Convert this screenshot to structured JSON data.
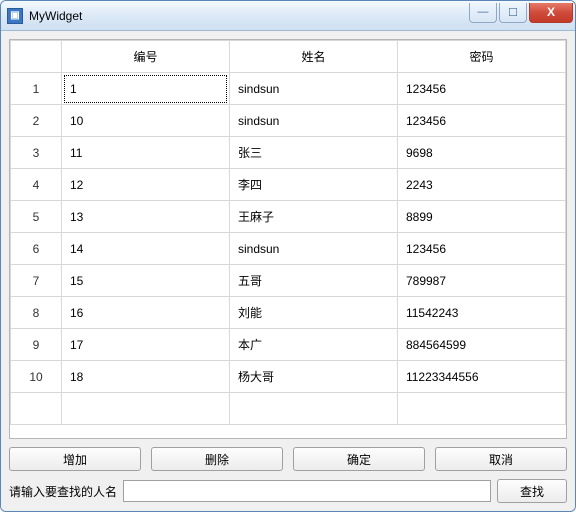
{
  "window": {
    "title": "MyWidget",
    "icon_glyph": "▣"
  },
  "window_controls": {
    "min": "—",
    "max": "☐",
    "close": "X"
  },
  "table": {
    "headers": {
      "id": "编号",
      "name": "姓名",
      "pwd": "密码"
    },
    "rows": [
      {
        "n": "1",
        "id": "1",
        "name": "sindsun",
        "pwd": "123456"
      },
      {
        "n": "2",
        "id": "10",
        "name": "sindsun",
        "pwd": "123456"
      },
      {
        "n": "3",
        "id": "11",
        "name": "张三",
        "pwd": "9698"
      },
      {
        "n": "4",
        "id": "12",
        "name": "李四",
        "pwd": "2243"
      },
      {
        "n": "5",
        "id": "13",
        "name": "王麻子",
        "pwd": "8899"
      },
      {
        "n": "6",
        "id": "14",
        "name": "sindsun",
        "pwd": "123456"
      },
      {
        "n": "7",
        "id": "15",
        "name": "五哥",
        "pwd": "789987"
      },
      {
        "n": "8",
        "id": "16",
        "name": "刘能",
        "pwd": "11542243"
      },
      {
        "n": "9",
        "id": "17",
        "name": "本广",
        "pwd": "884564599"
      },
      {
        "n": "10",
        "id": "18",
        "name": "杨大哥",
        "pwd": "11223344556"
      }
    ]
  },
  "buttons": {
    "add": "增加",
    "delete": "删除",
    "ok": "确定",
    "cancel": "取消",
    "search": "查找"
  },
  "search": {
    "label": "请输入要查找的人名",
    "value": ""
  }
}
